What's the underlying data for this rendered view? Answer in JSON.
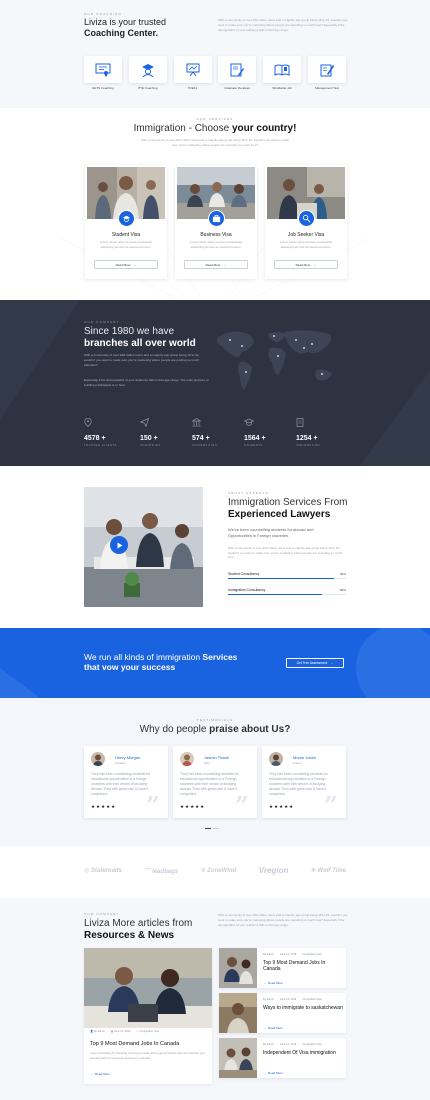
{
  "hero": {
    "kicker": "Our coaching",
    "title_line1": "Liviza is your trusted",
    "title_line2": "Coaching Center.",
    "paragraph": "With a community of over 400 million users and a majority age group being 18 to 34, wouldn't you want to make sure you're marketing where people are spending so much time? Especially if the demographic of your audience falls in that age range."
  },
  "services": [
    {
      "label": "IELTS Coaching",
      "icon": "certificate-icon"
    },
    {
      "label": "PTE Coaching",
      "icon": "graduate-icon"
    },
    {
      "label": "TOEFL",
      "icon": "presentation-icon"
    },
    {
      "label": "Graduate Re-Exam",
      "icon": "exam-pencil-icon"
    },
    {
      "label": "Worldwide Job",
      "icon": "open-book-icon"
    },
    {
      "label": "Management Test",
      "icon": "pencil-document-icon"
    }
  ],
  "countries": {
    "kicker": "Our services",
    "title_pre": "Immigration - Choose ",
    "title_bold": "your country!",
    "subtitle": "With a community of over 400 million users and a majority age group being 18 to 34, wouldn't you want to make sure you're marketing where people are spending so much time?",
    "cards": [
      {
        "title": "Student Visa",
        "desc": "Lorem ipsum dolor sit amet consectetur adipiscing elit sed do eiusmod tempor.",
        "button": "Read More"
      },
      {
        "title": "Business Visa",
        "desc": "Lorem ipsum dolor sit amet consectetur adipiscing elit sed do eiusmod tempor.",
        "button": "Read More"
      },
      {
        "title": "Job Seeker Visa",
        "desc": "Lorem ipsum dolor sit amet consectetur adipiscing elit sed do eiusmod tempor.",
        "button": "Read More"
      }
    ]
  },
  "branches": {
    "kicker": "Our company",
    "title_line1": "Since 1980 we have",
    "title_line2": "branches all over world",
    "paragraph1": "With a community of over 400 million users and a majority age group being 18 to 34, wouldn't you want to make sure you're marketing where people are posting so much attention?",
    "paragraph2": "Especially if the demographic of your audience falls in that age range. The main purpose of building participants is to host.",
    "stats": [
      {
        "value": "4578 +",
        "label": "Trusted Clients",
        "icon": "location-pin-icon"
      },
      {
        "value": "150 +",
        "label": "Countries",
        "icon": "paper-plane-icon"
      },
      {
        "value": "574 +",
        "label": "Universities",
        "icon": "bank-icon"
      },
      {
        "value": "1564 +",
        "label": "Students",
        "icon": "graduation-cap-icon"
      },
      {
        "value": "1254 +",
        "label": "Immigration",
        "icon": "document-icon"
      }
    ]
  },
  "lawyers": {
    "kicker": "About experts",
    "title_line1": "Immigration Services From",
    "title_line2": "Experienced Lawyers",
    "lead": "We've been counselling students for abroad and Opportunities in Foreign countries.",
    "paragraph": "With a community of over 400 million users and a majority age group being 18 to 34, wouldn't you want to make sure you're marketing where people are spending so much time.",
    "bars": [
      {
        "label": "Student Consultancy",
        "value": "90%",
        "pct": 90
      },
      {
        "label": "Immigration Consultancy",
        "value": "80%",
        "pct": 80
      }
    ]
  },
  "cta": {
    "line1_pre": "We run all kinds of immigration ",
    "line1_bold": "Services",
    "line2": "that vow your success",
    "button": "Get Free Assessment"
  },
  "testimonials": {
    "kicker": "Testimonials",
    "title_pre": "Why do people ",
    "title_bold": "praise about Us?",
    "items": [
      {
        "name": "Henry Morgan",
        "role": "Canada",
        "text": "They has been counselling students for educational opportunities in a foreign countries with their dream of studying abroad. They with great care & have it completed.",
        "stars": "★★★★★"
      },
      {
        "name": "Jasmin Thank",
        "role": "Italy",
        "text": "They has been counselling students for educational opportunities in a Foreign countries with their dream of studying abroad. They with great care & have it completed.",
        "stars": "★★★★★"
      },
      {
        "name": "Morris Joben",
        "role": "France",
        "text": "They has been counselling students for educational opportunities in a Foreign countries with their dream of studying abroad. They with great care & have it completed.",
        "stars": "★★★★★"
      }
    ]
  },
  "partners": [
    "Stateroads",
    "leadbags",
    "ZoneWind",
    "Vregion",
    "Wolf Time"
  ],
  "news": {
    "kicker": "Our company",
    "title_line1": "Liviza More articles from",
    "title_line2": "Resources & News",
    "paragraph": "With a community of over 400 million users and a majority age group being 18 to 34, wouldn't you want to make sure you're marketing where people are spending so much time? Especially if the demographic of your audience falls in that age range.",
    "featured": {
      "author": "By admin",
      "date": "June 12, 2019",
      "category": "Immigration Visa",
      "title": "Top 9 Most Demand Jobs In Canada",
      "desc": "Visa Consulting & Coaching Training provide with a good practice Service whether you should need for personal sessions in Canada.",
      "read": "Read More"
    },
    "list": [
      {
        "author": "By admin",
        "date": "June 12, 2019",
        "category": "Immigration Visa",
        "title": "Top 9 Most Demand Jobs In Canada",
        "read": "Read More"
      },
      {
        "author": "By admin",
        "date": "June 12, 2019",
        "category": "Immigration Visa",
        "title": "Ways to immigrate to saskatchewan",
        "read": "Read More"
      },
      {
        "author": "By admin",
        "date": "June 12, 2019",
        "category": "Immigration Visa",
        "title": "Independent Of Visa immigration",
        "read": "Read More"
      }
    ]
  },
  "colors": {
    "accent": "#1a63e0",
    "dark": "#2d3341",
    "light": "#f5f7fb"
  }
}
